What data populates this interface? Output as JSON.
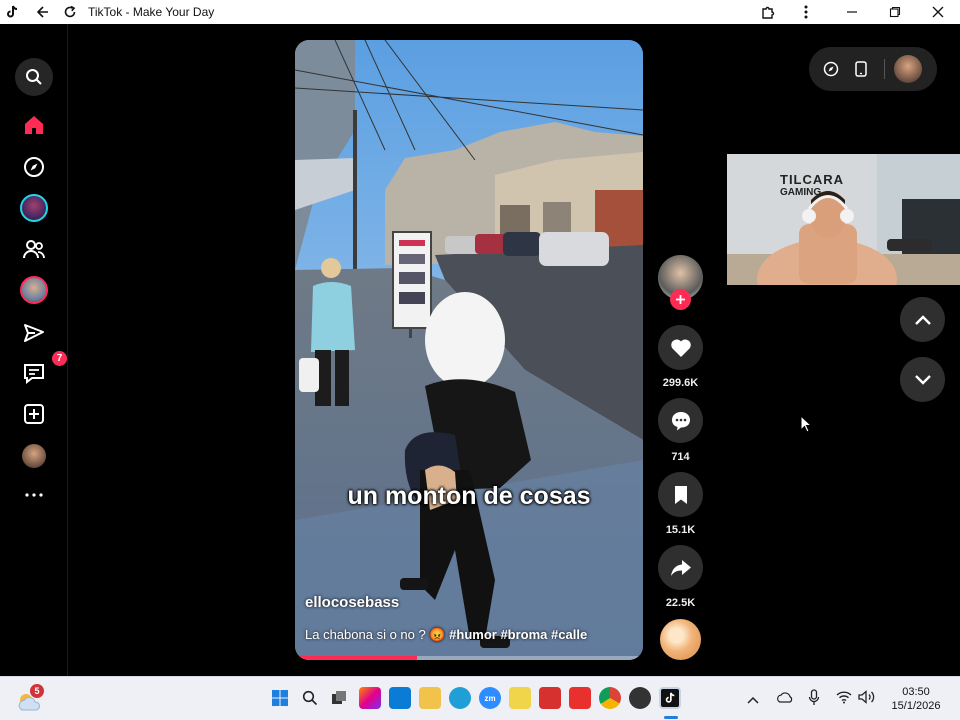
{
  "window": {
    "title": "TikTok - Make Your Day"
  },
  "sidebar": {
    "items": [
      {
        "name": "search-icon"
      },
      {
        "name": "home-icon",
        "color": "#fe2c55"
      },
      {
        "name": "explore-icon"
      },
      {
        "name": "live-avatar"
      },
      {
        "name": "following-icon"
      },
      {
        "name": "friend-avatar"
      },
      {
        "name": "messages-icon"
      },
      {
        "name": "inbox-icon",
        "badge": "7"
      },
      {
        "name": "upload-icon"
      },
      {
        "name": "profile-avatar"
      },
      {
        "name": "more-icon"
      }
    ]
  },
  "video": {
    "caption": "un monton de cosas",
    "username": "ellocosebass",
    "description": "La chabona si o no ?",
    "description_emoji": "😡",
    "hashtags": [
      "#humor",
      "#broma",
      "#calle"
    ],
    "progress": 0.35
  },
  "actions": {
    "likes": "299.6K",
    "comments": "714",
    "saves": "15.1K",
    "shares": "22.5K"
  },
  "webcam": {
    "wall_text_1": "TILCARA",
    "wall_text_2": "GAMING"
  },
  "taskbar": {
    "weather_badge": "5",
    "time": "03:50",
    "date": "15/1/2026"
  },
  "colors": {
    "accent": "#fe2c55",
    "button": "#2f2f2f"
  }
}
